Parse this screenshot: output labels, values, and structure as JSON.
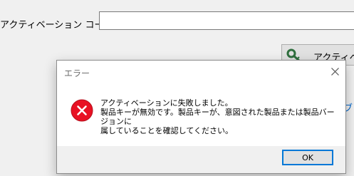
{
  "background": {
    "activation_code_label": "アクティベーション コード(V):",
    "activate_button_label": "アクティベ",
    "side_link": "ブ"
  },
  "dialog": {
    "title": "エラー",
    "icon": "error-circle-icon",
    "message_lines": [
      "アクティベーションに失敗しました。",
      "製品キーが無効です。製品キーが、意図された製品または製品バージョンに",
      "属していることを確認してください。"
    ],
    "ok_label": "OK"
  },
  "colors": {
    "error_red": "#e81123",
    "accent_blue": "#0078d7",
    "link_blue": "#0066cc"
  }
}
